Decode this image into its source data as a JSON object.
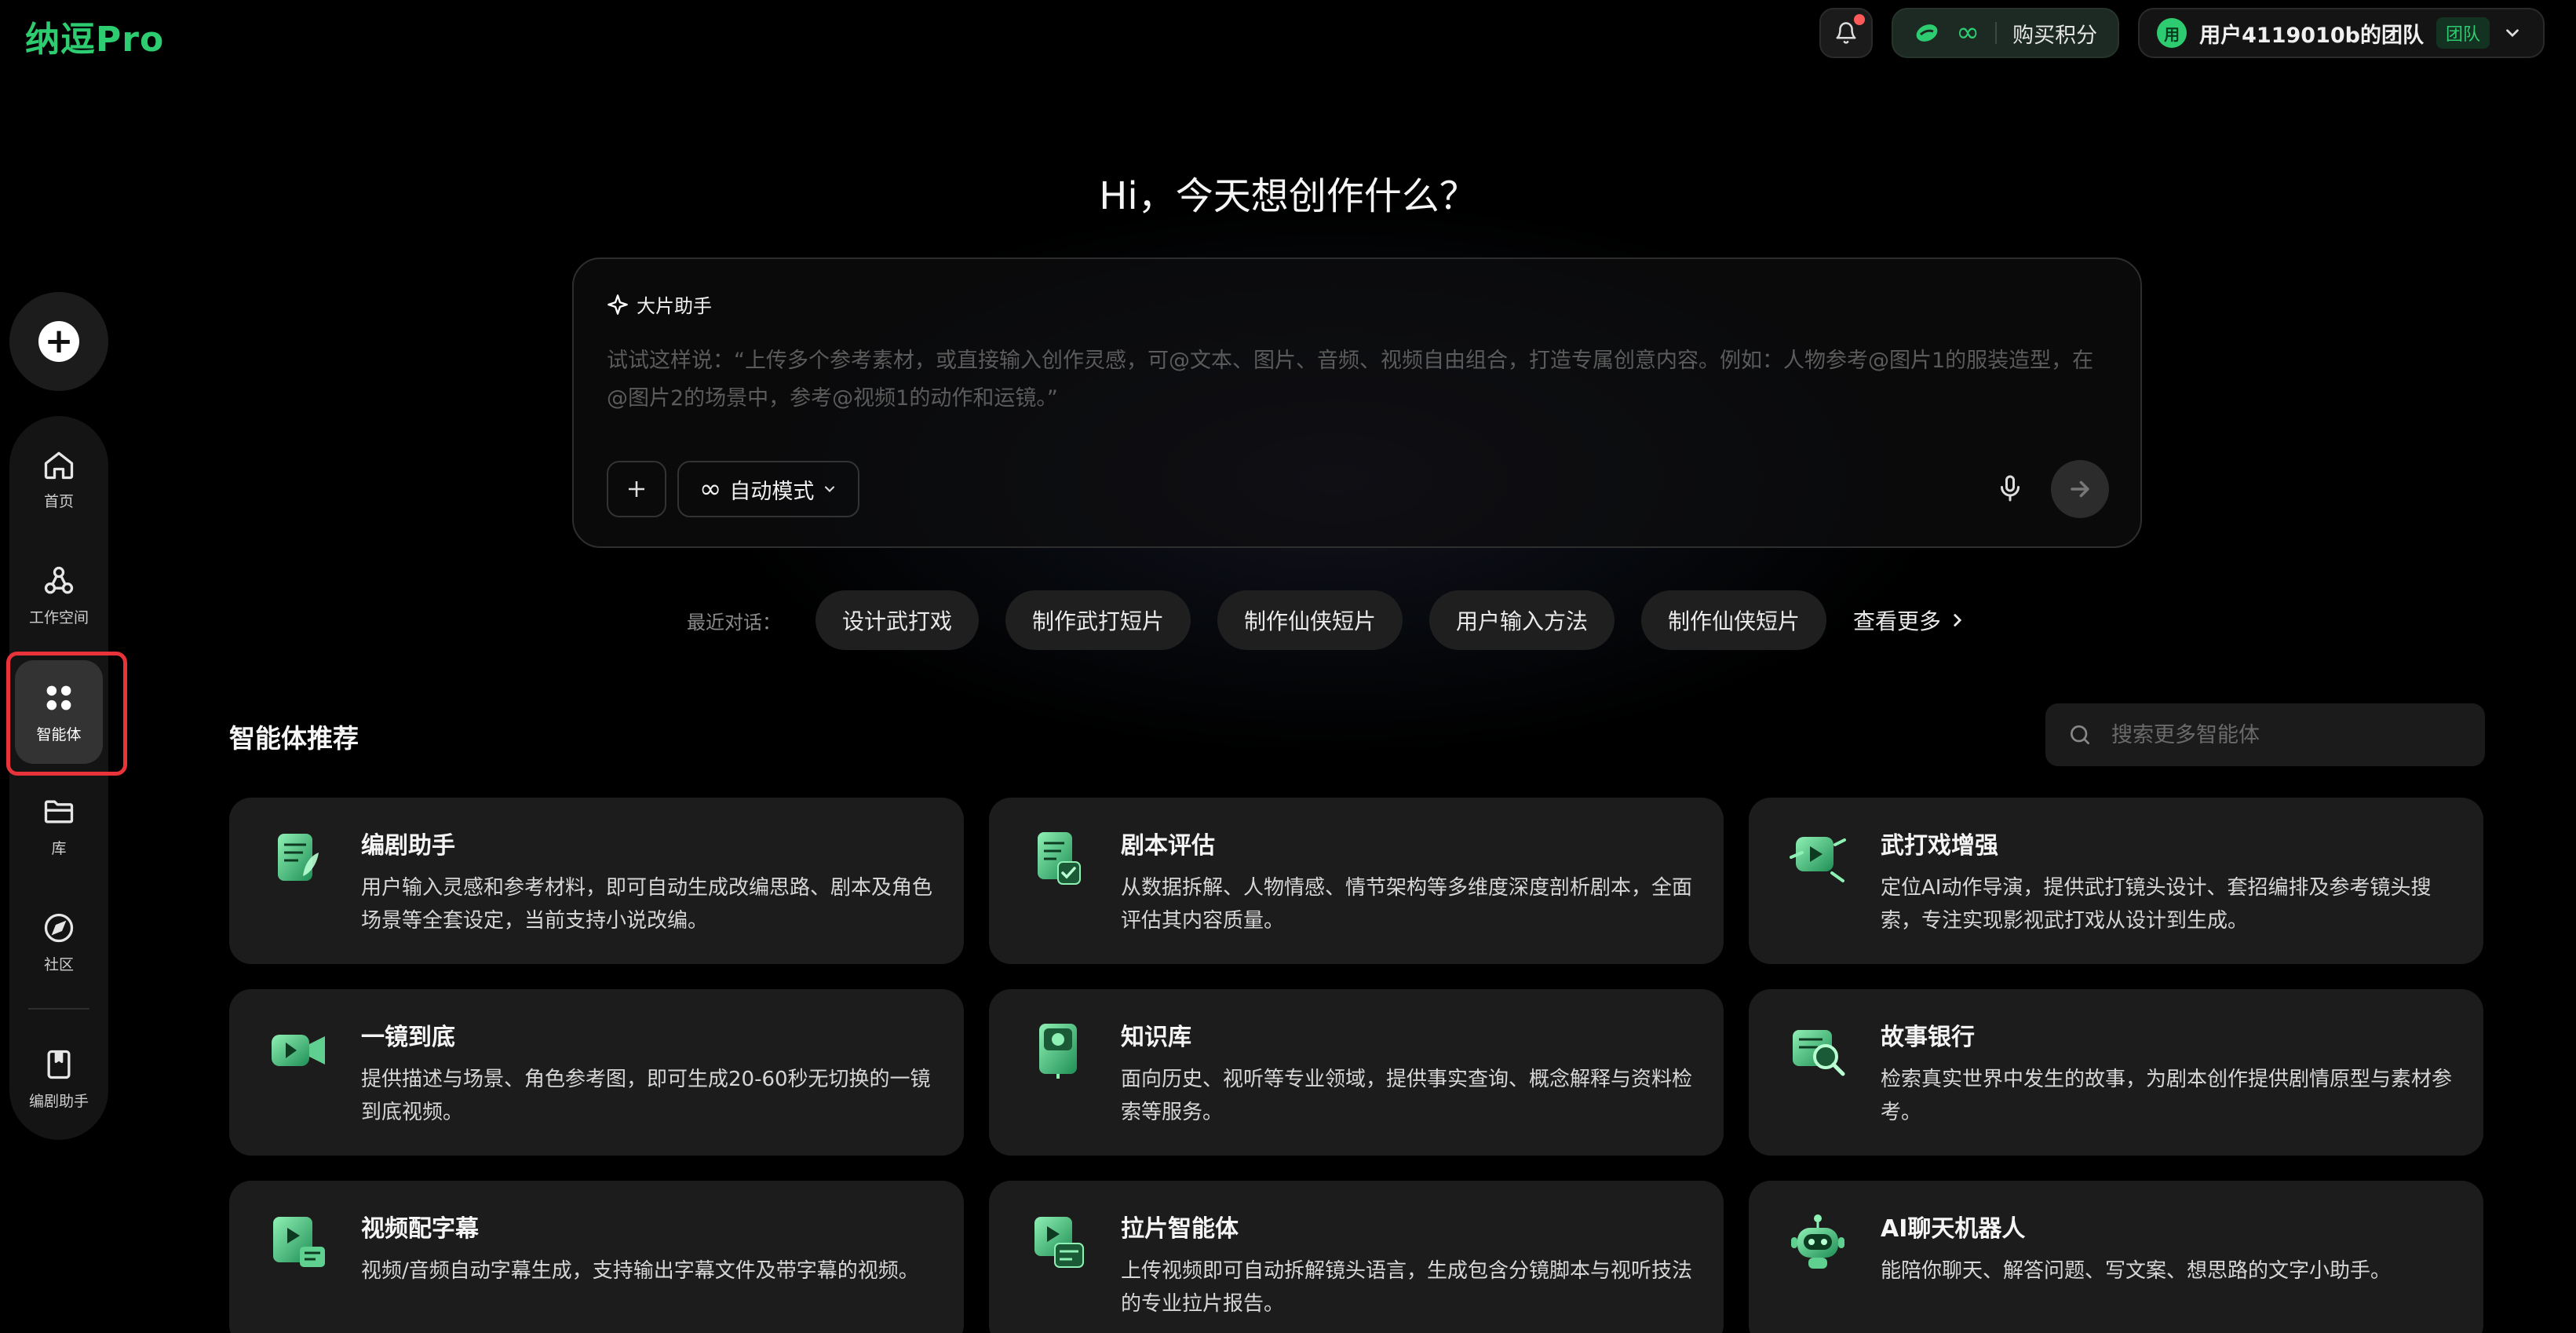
{
  "brand": {
    "logo": "纳逗Pro",
    "accent": "#2ecc71"
  },
  "topbar": {
    "credits_symbol": "∞",
    "buy_label": "购买积分",
    "team_avatar": "用",
    "team_name": "用户4119010b的团队",
    "team_tag": "团队"
  },
  "sidebar": {
    "new_icon": "plus-icon",
    "items": [
      {
        "label": "首页",
        "icon": "home-icon"
      },
      {
        "label": "工作空间",
        "icon": "workspace-icon"
      },
      {
        "label": "智能体",
        "icon": "apps-icon",
        "active": true
      },
      {
        "label": "库",
        "icon": "folder-icon"
      },
      {
        "label": "社区",
        "icon": "compass-icon"
      },
      {
        "label": "编剧助手",
        "icon": "script-icon"
      }
    ]
  },
  "hero": {
    "title": "Hi，今天想创作什么？"
  },
  "composer": {
    "assistant_label": "大片助手",
    "placeholder": "试试这样说：“上传多个参考素材，或直接输入创作灵感，可@文本、图片、音频、视频自由组合，打造专属创意内容。例如：人物参考@图片1的服装造型，在@图片2的场景中，参考@视频1的动作和运镜。”",
    "mode_label": "自动模式",
    "mode_symbol": "∞"
  },
  "recent": {
    "label": "最近对话：",
    "chips": [
      "设计武打戏",
      "制作武打短片",
      "制作仙侠短片",
      "用户输入方法",
      "制作仙侠短片"
    ],
    "more_label": "查看更多"
  },
  "agents": {
    "title": "智能体推荐",
    "search_placeholder": "搜索更多智能体",
    "cards": [
      {
        "title": "编剧助手",
        "desc": "用户输入灵感和参考材料，即可自动生成改编思路、剧本及角色场景等全套设定，当前支持小说改编。",
        "icon": "script-doc-icon"
      },
      {
        "title": "剧本评估",
        "desc": "从数据拆解、人物情感、情节架构等多维度深度剖析剧本，全面评估其内容质量。",
        "icon": "check-doc-icon"
      },
      {
        "title": "武打戏增强",
        "desc": "定位AI动作导演，提供武打镜头设计、套招编排及参考镜头搜索，专注实现影视武打戏从设计到生成。",
        "icon": "action-video-icon"
      },
      {
        "title": "一镜到底",
        "desc": "提供描述与场景、角色参考图，即可生成20-60秒无切换的一镜到底视频。",
        "icon": "camera-icon"
      },
      {
        "title": "知识库",
        "desc": "面向历史、视听等专业领域，提供事实查询、概念解释与资料检索等服务。",
        "icon": "book-icon"
      },
      {
        "title": "故事银行",
        "desc": "检索真实世界中发生的故事，为剧本创作提供剧情原型与素材参考。",
        "icon": "story-search-icon"
      },
      {
        "title": "视频配字幕",
        "desc": "视频/音频自动字幕生成，支持输出字幕文件及带字幕的视频。",
        "icon": "subtitle-icon"
      },
      {
        "title": "拉片智能体",
        "desc": "上传视频即可自动拆解镜头语言，生成包含分镜脚本与视听技法的专业拉片报告。",
        "icon": "film-analysis-icon"
      },
      {
        "title": "AI聊天机器人",
        "desc": "能陪你聊天、解答问题、写文案、想思路的文字小助手。",
        "icon": "robot-icon"
      }
    ]
  }
}
